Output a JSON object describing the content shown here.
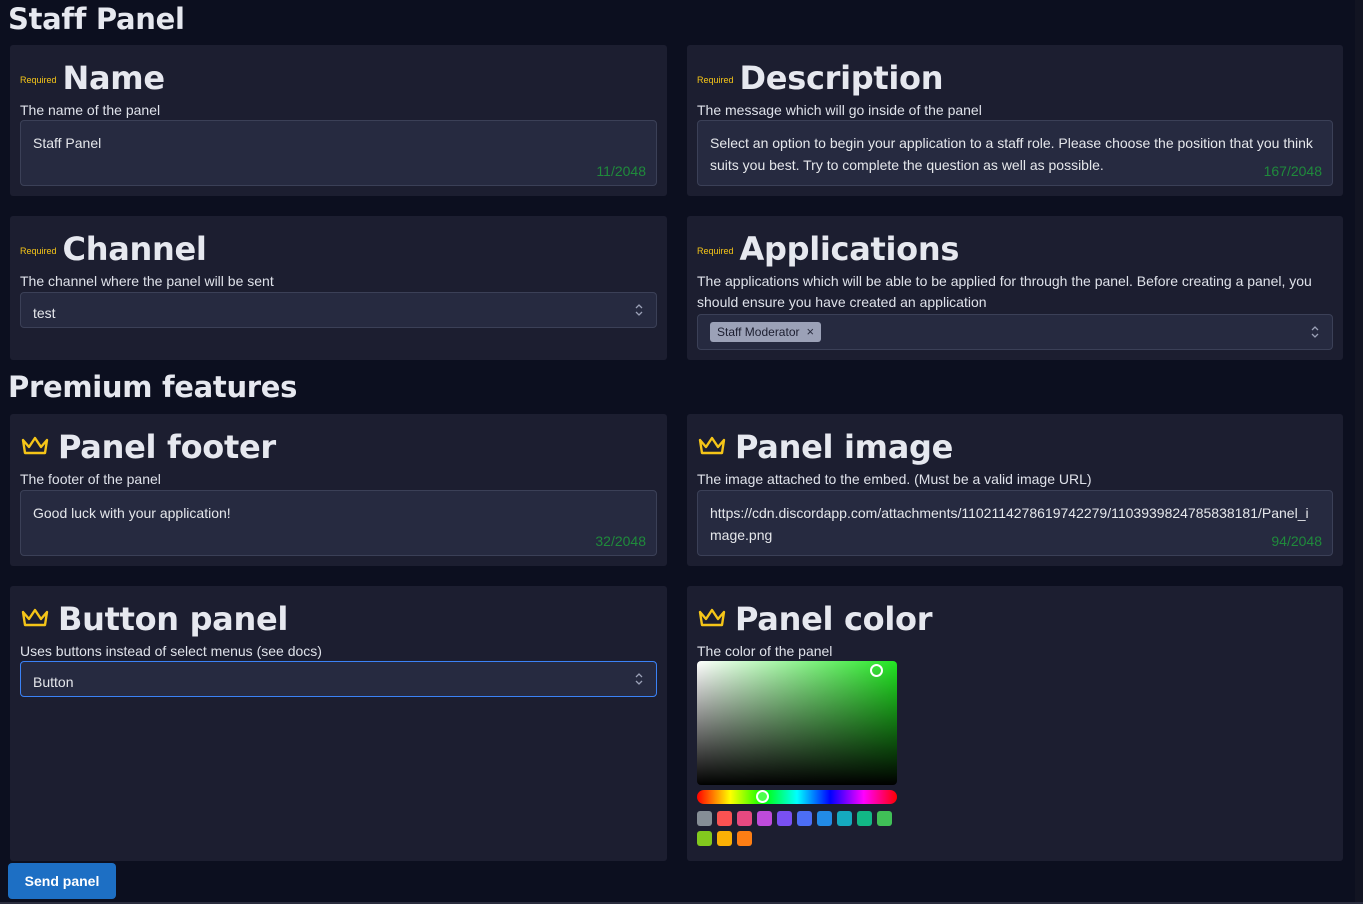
{
  "page_title": "Staff Panel",
  "required_label": "Required",
  "name": {
    "title": "Name",
    "description": "The name of the panel",
    "value": "Staff Panel",
    "count": "11/2048"
  },
  "description": {
    "title": "Description",
    "description": "The message which will go inside of the panel",
    "value": "Select an option to begin your application to a staff role. Please choose the position that you think suits you best. Try to complete the question as well as possible.",
    "count": "167/2048"
  },
  "channel": {
    "title": "Channel",
    "description": "The channel where the panel will be sent",
    "value": "test"
  },
  "applications": {
    "title": "Applications",
    "description": "The applications which will be able to be applied for through the panel. Before creating a panel, you should ensure you have created an application",
    "tag": "Staff Moderator"
  },
  "premium_title": "Premium features",
  "panel_footer": {
    "title": "Panel footer",
    "description": "The footer of the panel",
    "value": "Good luck with your application!",
    "count": "32/2048"
  },
  "panel_image": {
    "title": "Panel image",
    "description": "The image attached to the embed. (Must be a valid image URL)",
    "value": "https://cdn.discordapp.com/attachments/1102114278619742279/1103939824785838181/Panel_image.png",
    "count": "94/2048"
  },
  "button_panel": {
    "title": "Button panel",
    "description": "Uses buttons instead of select menus (see docs)",
    "value": "Button"
  },
  "panel_color": {
    "title": "Panel color",
    "description": "The color of the panel",
    "selected_color": "#22e622",
    "swatches": [
      "#868e96",
      "#fa5252",
      "#e64980",
      "#be4bdb",
      "#7950f2",
      "#4c6ef5",
      "#228be6",
      "#15aabf",
      "#12b886",
      "#40c057",
      "#82c91e",
      "#fab005",
      "#fd7e14"
    ]
  },
  "send_button": "Send panel",
  "colors": {
    "background": "#0c0f1f",
    "card": "#1c1e30",
    "required": "#f5c518",
    "counter": "#1f8a3b",
    "accent": "#1d6fc4",
    "crown": "#f5c518"
  }
}
